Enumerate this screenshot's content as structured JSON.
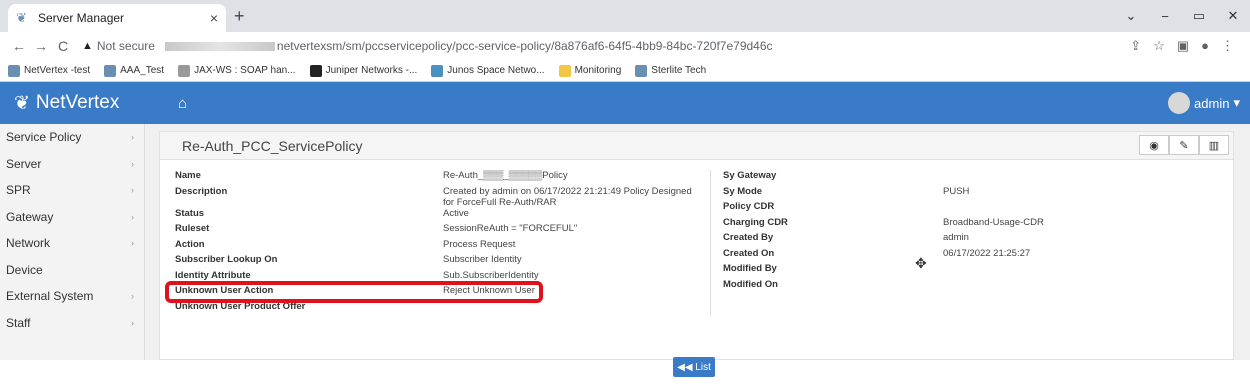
{
  "browser": {
    "tab_title": "Server Manager",
    "tab_close": "×",
    "new_tab": "+",
    "window_controls": [
      "⌄",
      "−",
      "▭",
      "✕"
    ],
    "url_warning": "Not secure",
    "url_path": "netvertexsm/sm/pccservicepolicy/pcc-service-policy/8a876af6-64f5-4bb9-84bc-720f7e79d46c",
    "bookmarks": [
      {
        "label": "NetVertex -test",
        "color": "#6a8fb0"
      },
      {
        "label": "AAA_Test",
        "color": "#6a8fb0"
      },
      {
        "label": "JAX-WS : SOAP han...",
        "color": "#999999"
      },
      {
        "label": "Juniper Networks -...",
        "color": "#222222"
      },
      {
        "label": "Junos Space Netwo...",
        "color": "#4a90c0"
      },
      {
        "label": "Monitoring",
        "color": "#f3c744"
      },
      {
        "label": "Sterlite Tech",
        "color": "#6a8fb0"
      }
    ]
  },
  "app": {
    "logo": "NetVertex",
    "user": "admin",
    "sidebar": [
      {
        "label": "Service Policy",
        "caret": true
      },
      {
        "label": "Server",
        "caret": true
      },
      {
        "label": "SPR",
        "caret": true
      },
      {
        "label": "Gateway",
        "caret": true
      },
      {
        "label": "Network",
        "caret": true
      },
      {
        "label": "Device",
        "caret": false
      },
      {
        "label": "External System",
        "caret": true
      },
      {
        "label": "Staff",
        "caret": true
      }
    ],
    "panel_title": "Re-Auth_PCC_ServicePolicy",
    "list_button": "◀◀ List"
  },
  "left_fields": [
    {
      "key": "Name",
      "value": "Re-Auth_▒▒▒_▒▒▒▒▒Policy"
    },
    {
      "key": "Description",
      "value": "Created by admin on 06/17/2022 21:21:49 Policy Designed for ForceFull Re-Auth/RAR"
    },
    {
      "key": "Status",
      "value": "Active"
    },
    {
      "key": "Ruleset",
      "value": "SessionReAuth = \"FORCEFUL\""
    },
    {
      "key": "Action",
      "value": "Process Request"
    },
    {
      "key": "Subscriber Lookup On",
      "value": "Subscriber Identity"
    },
    {
      "key": "Identity Attribute",
      "value": "Sub.SubscriberIdentity"
    },
    {
      "key": "Unknown User Action",
      "value": "Reject Unknown User"
    },
    {
      "key": "Unknown User Product Offer",
      "value": ""
    }
  ],
  "right_fields": [
    {
      "key": "Sy Gateway",
      "value": ""
    },
    {
      "key": "Sy Mode",
      "value": "PUSH"
    },
    {
      "key": "Policy CDR",
      "value": ""
    },
    {
      "key": "Charging CDR",
      "value": "Broadband-Usage-CDR"
    },
    {
      "key": "Created By",
      "value": "admin"
    },
    {
      "key": "Created On",
      "value": "06/17/2022 21:25:27"
    },
    {
      "key": "Modified By",
      "value": ""
    },
    {
      "key": "Modified On",
      "value": ""
    }
  ]
}
